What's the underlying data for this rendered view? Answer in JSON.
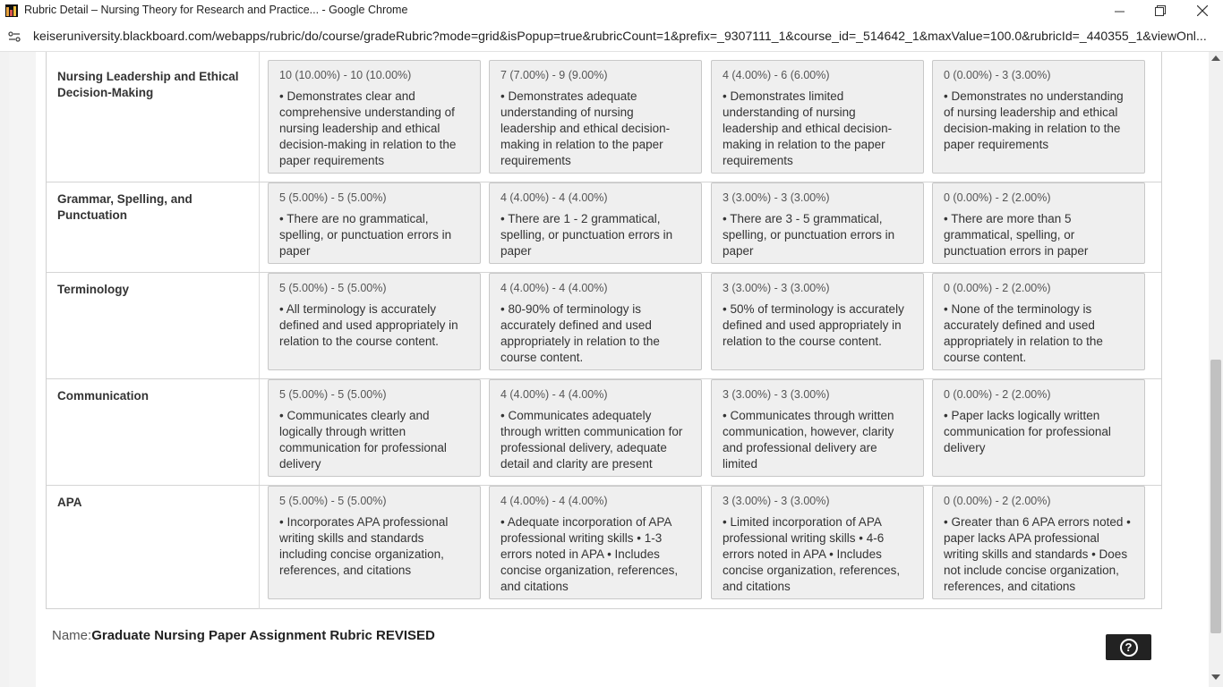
{
  "window": {
    "title": "Rubric Detail – Nursing Theory for Research and Practice... - Google Chrome",
    "minimize_icon": "minimize-icon",
    "restore_icon": "restore-icon",
    "close_icon": "close-icon"
  },
  "address_bar": {
    "url": "keiseruniversity.blackboard.com/webapps/rubric/do/course/gradeRubric?mode=grid&isPopup=true&rubricCount=1&prefix=_9307111_1&course_id=_514642_1&maxValue=100.0&rubricId=_440355_1&viewOnl..."
  },
  "rubric": {
    "rows": [
      {
        "title": "Nursing Leadership and Ethical Decision-Making",
        "cells": [
          {
            "points": "10 (10.00%) - 10 (10.00%)",
            "desc": "• Demonstrates clear and comprehensive understanding of nursing leadership and ethical decision-making in relation to the paper requirements"
          },
          {
            "points": "7 (7.00%) - 9 (9.00%)",
            "desc": "• Demonstrates adequate understanding of nursing leadership and ethical decision-making in relation to the paper requirements"
          },
          {
            "points": "4 (4.00%) - 6 (6.00%)",
            "desc": "• Demonstrates limited understanding of nursing leadership and ethical decision-making in relation to the paper requirements"
          },
          {
            "points": "0 (0.00%) - 3 (3.00%)",
            "desc": "• Demonstrates no understanding of nursing leadership and ethical decision-making in relation to the paper requirements"
          }
        ]
      },
      {
        "title": "Grammar, Spelling, and Punctuation",
        "cells": [
          {
            "points": "5 (5.00%) - 5 (5.00%)",
            "desc": "• There are no grammatical, spelling, or punctuation errors in paper"
          },
          {
            "points": "4 (4.00%) - 4 (4.00%)",
            "desc": "• There are 1 - 2 grammatical, spelling, or punctuation errors in paper"
          },
          {
            "points": "3 (3.00%) - 3 (3.00%)",
            "desc": "• There are 3 - 5 grammatical, spelling, or punctuation errors in paper"
          },
          {
            "points": "0 (0.00%) - 2 (2.00%)",
            "desc": "• There are more than 5 grammatical, spelling, or punctuation errors in paper"
          }
        ]
      },
      {
        "title": "Terminology",
        "cells": [
          {
            "points": "5 (5.00%) - 5 (5.00%)",
            "desc": "• All terminology is accurately defined and used appropriately in relation to the course content."
          },
          {
            "points": "4 (4.00%) - 4 (4.00%)",
            "desc": "• 80-90% of terminology is accurately defined and used appropriately in relation to the course content."
          },
          {
            "points": "3 (3.00%) - 3 (3.00%)",
            "desc": "• 50% of terminology is accurately defined and used appropriately in relation to the course content."
          },
          {
            "points": "0 (0.00%) - 2 (2.00%)",
            "desc": "• None of the terminology is accurately defined and used appropriately in relation to the course content."
          }
        ]
      },
      {
        "title": "Communication",
        "cells": [
          {
            "points": "5 (5.00%) - 5 (5.00%)",
            "desc": "• Communicates clearly and logically through written communication for professional delivery"
          },
          {
            "points": "4 (4.00%) - 4 (4.00%)",
            "desc": "• Communicates adequately through written communication for professional delivery, adequate detail and clarity are present"
          },
          {
            "points": "3 (3.00%) - 3 (3.00%)",
            "desc": "• Communicates through written communication, however, clarity and professional delivery are limited"
          },
          {
            "points": "0 (0.00%) - 2 (2.00%)",
            "desc": "• Paper lacks logically written communication for professional delivery"
          }
        ]
      },
      {
        "title": "APA",
        "cells": [
          {
            "points": "5 (5.00%) - 5 (5.00%)",
            "desc": "• Incorporates APA professional writing skills and standards including concise organization, references, and citations"
          },
          {
            "points": "4 (4.00%) - 4 (4.00%)",
            "desc": "• Adequate incorporation of APA professional writing skills • 1-3 errors noted in APA • Includes concise organization, references, and citations"
          },
          {
            "points": "3 (3.00%) - 3 (3.00%)",
            "desc": "• Limited incorporation of APA professional writing skills • 4-6 errors noted in APA • Includes concise organization, references, and citations"
          },
          {
            "points": "0 (0.00%) - 2 (2.00%)",
            "desc": "• Greater than 6 APA errors noted • paper lacks APA professional writing skills and standards • Does not include concise organization, references, and citations"
          }
        ]
      }
    ]
  },
  "footer": {
    "name_label": "Name:",
    "name_value": "Graduate Nursing Paper Assignment Rubric REVISED",
    "help_icon": "help-icon"
  },
  "colors": {
    "cell_bg": "#efefef",
    "cell_border": "#c8c8c8",
    "help_button_bg": "#222222"
  }
}
